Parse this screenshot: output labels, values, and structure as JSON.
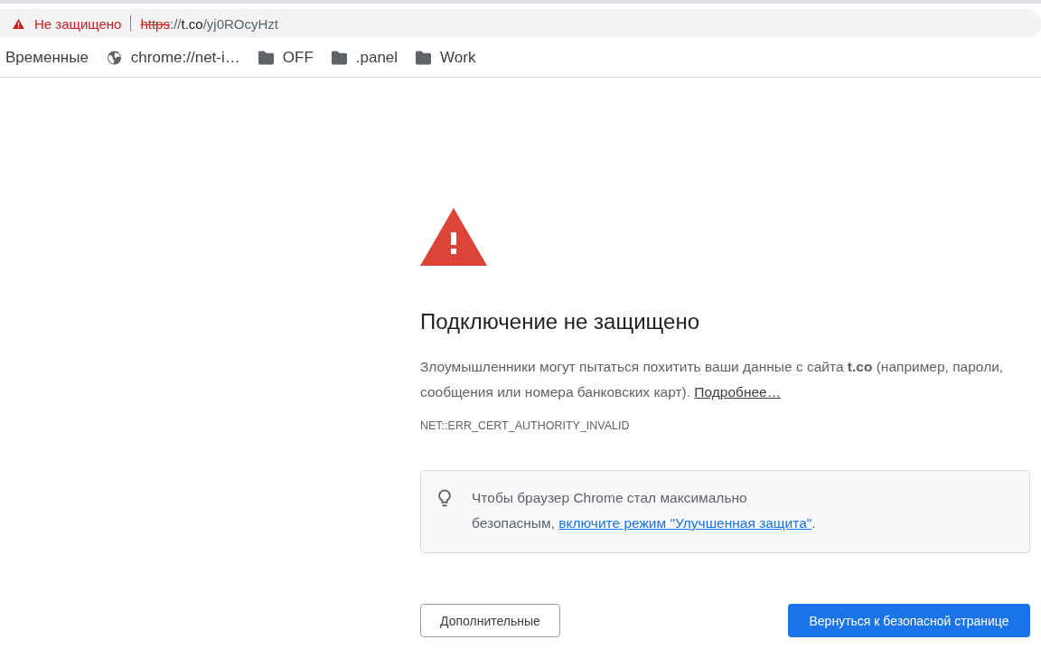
{
  "address_bar": {
    "security_label": "Не защищено",
    "url_parts": [
      {
        "kind": "scheme",
        "text": "https"
      },
      {
        "kind": "muted",
        "text": "://"
      },
      {
        "kind": "host",
        "text": "t.co"
      },
      {
        "kind": "muted",
        "text": "/yj0ROcyHzt"
      }
    ]
  },
  "bookmarks": [
    {
      "kind": "plain",
      "label": "Временные"
    },
    {
      "kind": "globe",
      "label": "chrome://net-i…"
    },
    {
      "kind": "folder",
      "label": "OFF"
    },
    {
      "kind": "folder",
      "label": ".panel"
    },
    {
      "kind": "folder",
      "label": "Work"
    }
  ],
  "error_page": {
    "heading": "Подключение не защищено",
    "paragraph": "Злоумышленники могут пытаться похитить ваши данные с сайта **t.co** (например, пароли, сообщения или номера банковских карт).",
    "details_link": "Подробнее…",
    "error_code": "NET::ERR_CERT_AUTHORITY_INVALID",
    "tip": {
      "text": "Чтобы браузер Chrome стал максимально безопасным,",
      "link": "включите режим \"Улучшенная защита\"",
      "end": "."
    },
    "advanced_button": "Дополнительные",
    "back_button": "Вернуться к безопасной странице"
  }
}
